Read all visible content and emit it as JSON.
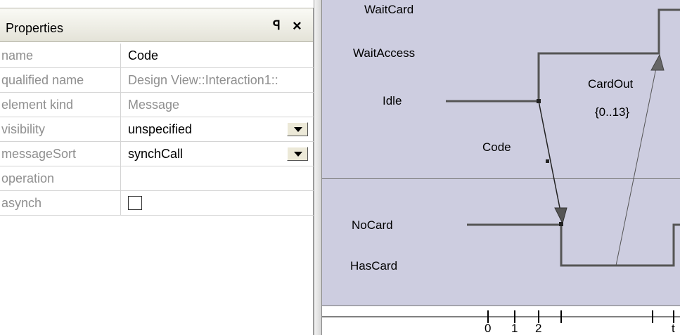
{
  "properties_panel": {
    "title": "Properties",
    "pin_glyph": "ᵽ",
    "close_glyph": "×",
    "rows": [
      {
        "key": "name",
        "value": "Code"
      },
      {
        "key": "qualified name",
        "value": "Design View::Interaction1::"
      },
      {
        "key": "element kind",
        "value": "Message"
      },
      {
        "key": "visibility",
        "value": "unspecified"
      },
      {
        "key": "messageSort",
        "value": "synchCall"
      },
      {
        "key": "operation",
        "value": ""
      },
      {
        "key": "asynch",
        "value": ""
      }
    ]
  },
  "diagram": {
    "lifeline1_states": [
      "WaitCard",
      "WaitAccess",
      "Idle"
    ],
    "lifeline2_states": [
      "NoCard",
      "HasCard"
    ],
    "messages": [
      {
        "name": "Code"
      },
      {
        "name": "CardOut",
        "constraint": "{0..13}"
      }
    ],
    "ruler_ticks": [
      "0",
      "1",
      "2",
      "t"
    ],
    "colors": {
      "lane_background": "#cdcde0",
      "line": "#555555"
    }
  }
}
